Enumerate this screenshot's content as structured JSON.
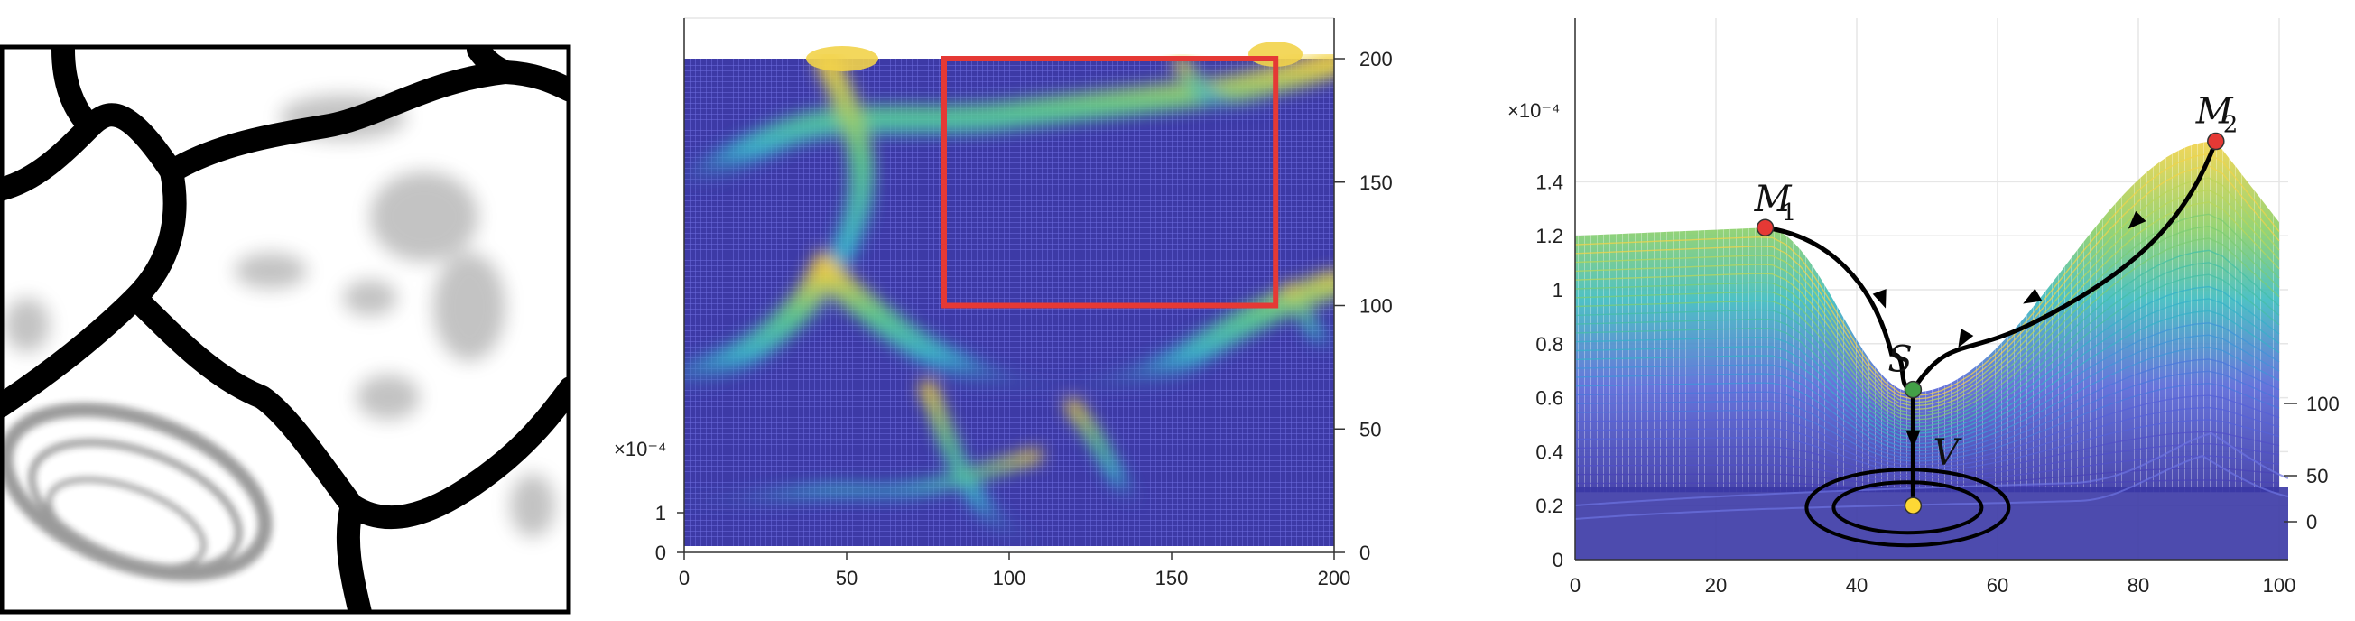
{
  "panels": [
    {
      "id": "a",
      "kind": "binary-probability-map",
      "description": "grayscale segmentation/probability map with thick black curving boundaries"
    },
    {
      "id": "b",
      "kind": "surface-mesh",
      "axes": {
        "x_ticks": [
          "0",
          "50",
          "100",
          "150",
          "200"
        ],
        "y_ticks_right": [
          "0",
          "50",
          "100",
          "150",
          "200"
        ],
        "z_ticks_left": [
          "0",
          "1"
        ],
        "z_exponent": "×10⁻⁴"
      },
      "highlight_box": {
        "x_range": [
          80,
          182
        ],
        "y_range": [
          100,
          200
        ],
        "color": "#e53935"
      }
    },
    {
      "id": "c",
      "kind": "surface-mesh-zoom",
      "axes": {
        "x_ticks": [
          "0",
          "20",
          "40",
          "60",
          "80",
          "100"
        ],
        "z_ticks_left": [
          "0",
          "0.2",
          "0.4",
          "0.6",
          "0.8",
          "1",
          "1.2",
          "1.4"
        ],
        "z_exponent": "×10⁻⁴",
        "y_ticks_right": [
          "0",
          "50",
          "100"
        ]
      },
      "points": [
        {
          "label": "M",
          "subscript": "1",
          "x": 27,
          "z": 1.23,
          "color": "#e53935"
        },
        {
          "label": "M",
          "subscript": "2",
          "x": 91,
          "z": 1.55,
          "color": "#e53935"
        },
        {
          "label": "S",
          "subscript": "",
          "x": 48,
          "z": 0.63,
          "color": "#43a047"
        },
        {
          "label": "V",
          "subscript": "",
          "x": 48,
          "z": 0.2,
          "color": "#fdd835"
        }
      ]
    }
  ],
  "colors": {
    "mesh_low": "#3a3aa8",
    "mesh_mid": "#3cb8c8",
    "mesh_high": "#f6d23c",
    "boundary": "#000000",
    "grid": "#e6e6e6"
  }
}
